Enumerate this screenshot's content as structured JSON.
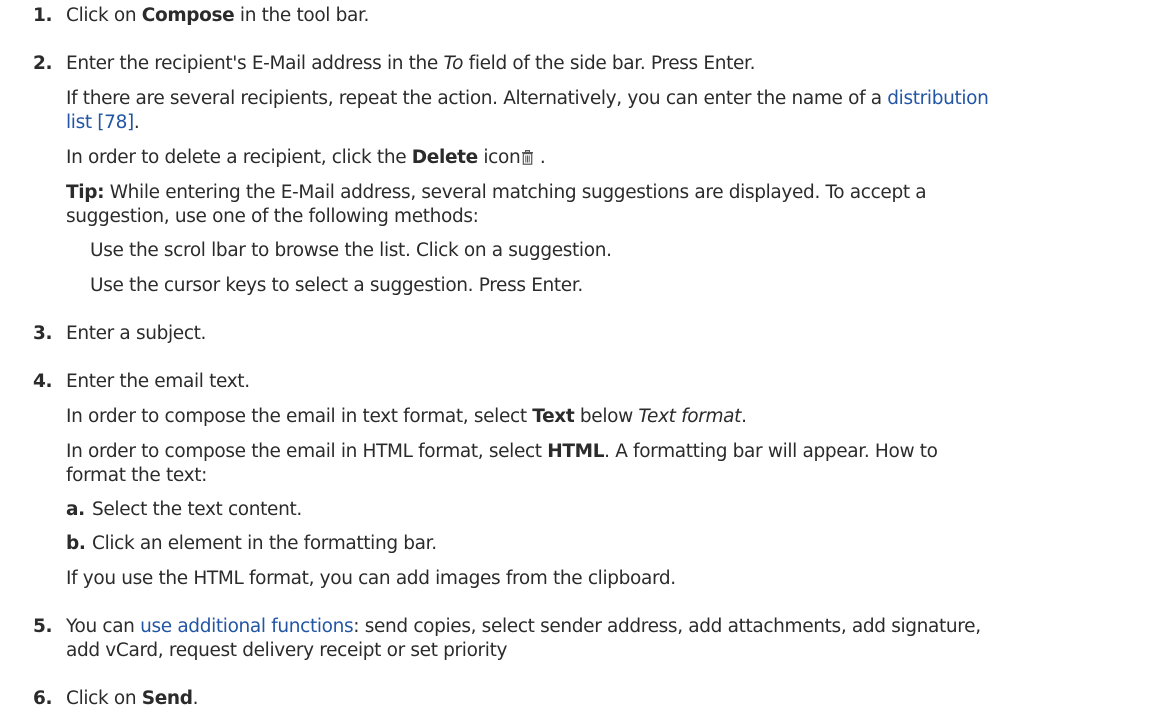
{
  "steps": [
    {
      "num": "1.",
      "pre": "Click on ",
      "bold": "Compose",
      "post": " in the tool bar."
    },
    {
      "num": "2.",
      "main_pre": "Enter the recipient's E-Mail address in the ",
      "main_italic": "To",
      "main_post": " field of the side bar. Press Enter.",
      "multi_line1_pre": "If there are several recipients, repeat the action. Alternatively, you can enter the name of a ",
      "multi_link_line1": "distribution",
      "multi_link_line2": "list [78]",
      "multi_line2_post": ".",
      "delete_pre": "In order to delete a recipient, click the ",
      "delete_bold": "Delete",
      "delete_post": " icon",
      "delete_end": " .",
      "delete_icon": "trash-icon",
      "tip_label": "Tip:",
      "tip_line1": " While entering the E-Mail address, several matching suggestions are displayed. To accept a",
      "tip_line2": "suggestion, use one of the following methods:",
      "method1": "Use the scrol lbar to browse the list. Click on a suggestion.",
      "method2": "Use the cursor keys to select a suggestion. Press Enter."
    },
    {
      "num": "3.",
      "text": "Enter a subject."
    },
    {
      "num": "4.",
      "text": "Enter the email text.",
      "text_pre": "In order to compose the email in text format, select ",
      "text_bold": "Text",
      "text_mid": " below ",
      "text_italic": "Text format",
      "text_end": ".",
      "html_pre": "In order to compose the email in HTML format, select ",
      "html_bold": "HTML",
      "html_post": ". A formatting bar will appear. How to",
      "html_line2": "format the text:",
      "sub_a_label": "a.",
      "sub_a_text": "Select the text content.",
      "sub_b_label": "b.",
      "sub_b_text": "Click an element in the formatting bar.",
      "clipboard": "If you use the HTML format, you can add images from the clipboard."
    },
    {
      "num": "5.",
      "pre": "You can ",
      "link": "use additional functions",
      "post": ": send copies, select sender address, add attachments, add signature,",
      "line2": "add vCard, request delivery receipt or set priority"
    },
    {
      "num": "6.",
      "pre": "Click on ",
      "bold": "Send",
      "post": "."
    }
  ],
  "colors": {
    "text": "#2b2b2b",
    "link": "#2255a4"
  }
}
